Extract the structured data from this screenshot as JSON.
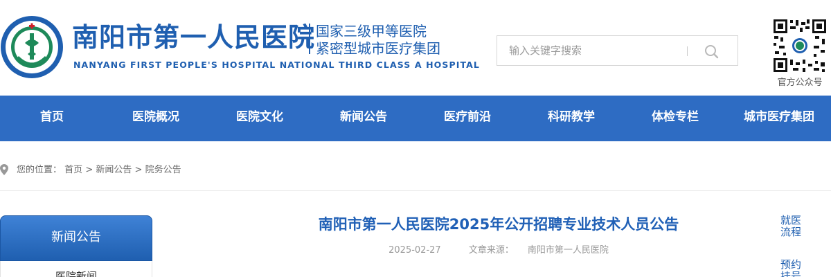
{
  "header": {
    "title_cn": "南阳市第一人民医院",
    "subtitle_line1": "国家三级甲等医院",
    "subtitle_line2": "紧密型城市医疗集团",
    "title_en": "NANYANG FIRST PEOPLE'S HOSPITAL NATIONAL THIRD CLASS A HOSPITAL",
    "emblem_text_top": "NANYANG FIRST PEOPLE'S HOSPITAL",
    "emblem_text_bottom": "南阳市第一人民医院"
  },
  "search": {
    "placeholder": "输入关键字搜索",
    "button_icon": "search-icon"
  },
  "qr": {
    "label": "官方公众号"
  },
  "nav": {
    "items": [
      {
        "label": "首页"
      },
      {
        "label": "医院概况"
      },
      {
        "label": "医院文化"
      },
      {
        "label": "新闻公告"
      },
      {
        "label": "医疗前沿"
      },
      {
        "label": "科研教学"
      },
      {
        "label": "体检专栏"
      },
      {
        "label": "城市医疗集团"
      }
    ]
  },
  "breadcrumb": {
    "prefix": "您的位置：",
    "items": [
      "首页",
      "新闻公告",
      "院务公告"
    ],
    "separator": ">"
  },
  "sidebar": {
    "heading": "新闻公告",
    "items": [
      {
        "label": "医院新闻"
      }
    ]
  },
  "article": {
    "title": "南阳市第一人民医院2025年公开招聘专业技术人员公告",
    "date": "2025-02-27",
    "source_label": "文章来源：",
    "source": "南阳市第一人民医院"
  },
  "float_links": [
    {
      "line1": "就医",
      "line2": "流程"
    },
    {
      "line1": "预约",
      "line2": "挂号"
    }
  ],
  "colors": {
    "brand_blue": "#1f5fb0",
    "nav_blue": "#2e6cc3",
    "logo_green": "#1e8a5a",
    "logo_red": "#d0202a"
  }
}
